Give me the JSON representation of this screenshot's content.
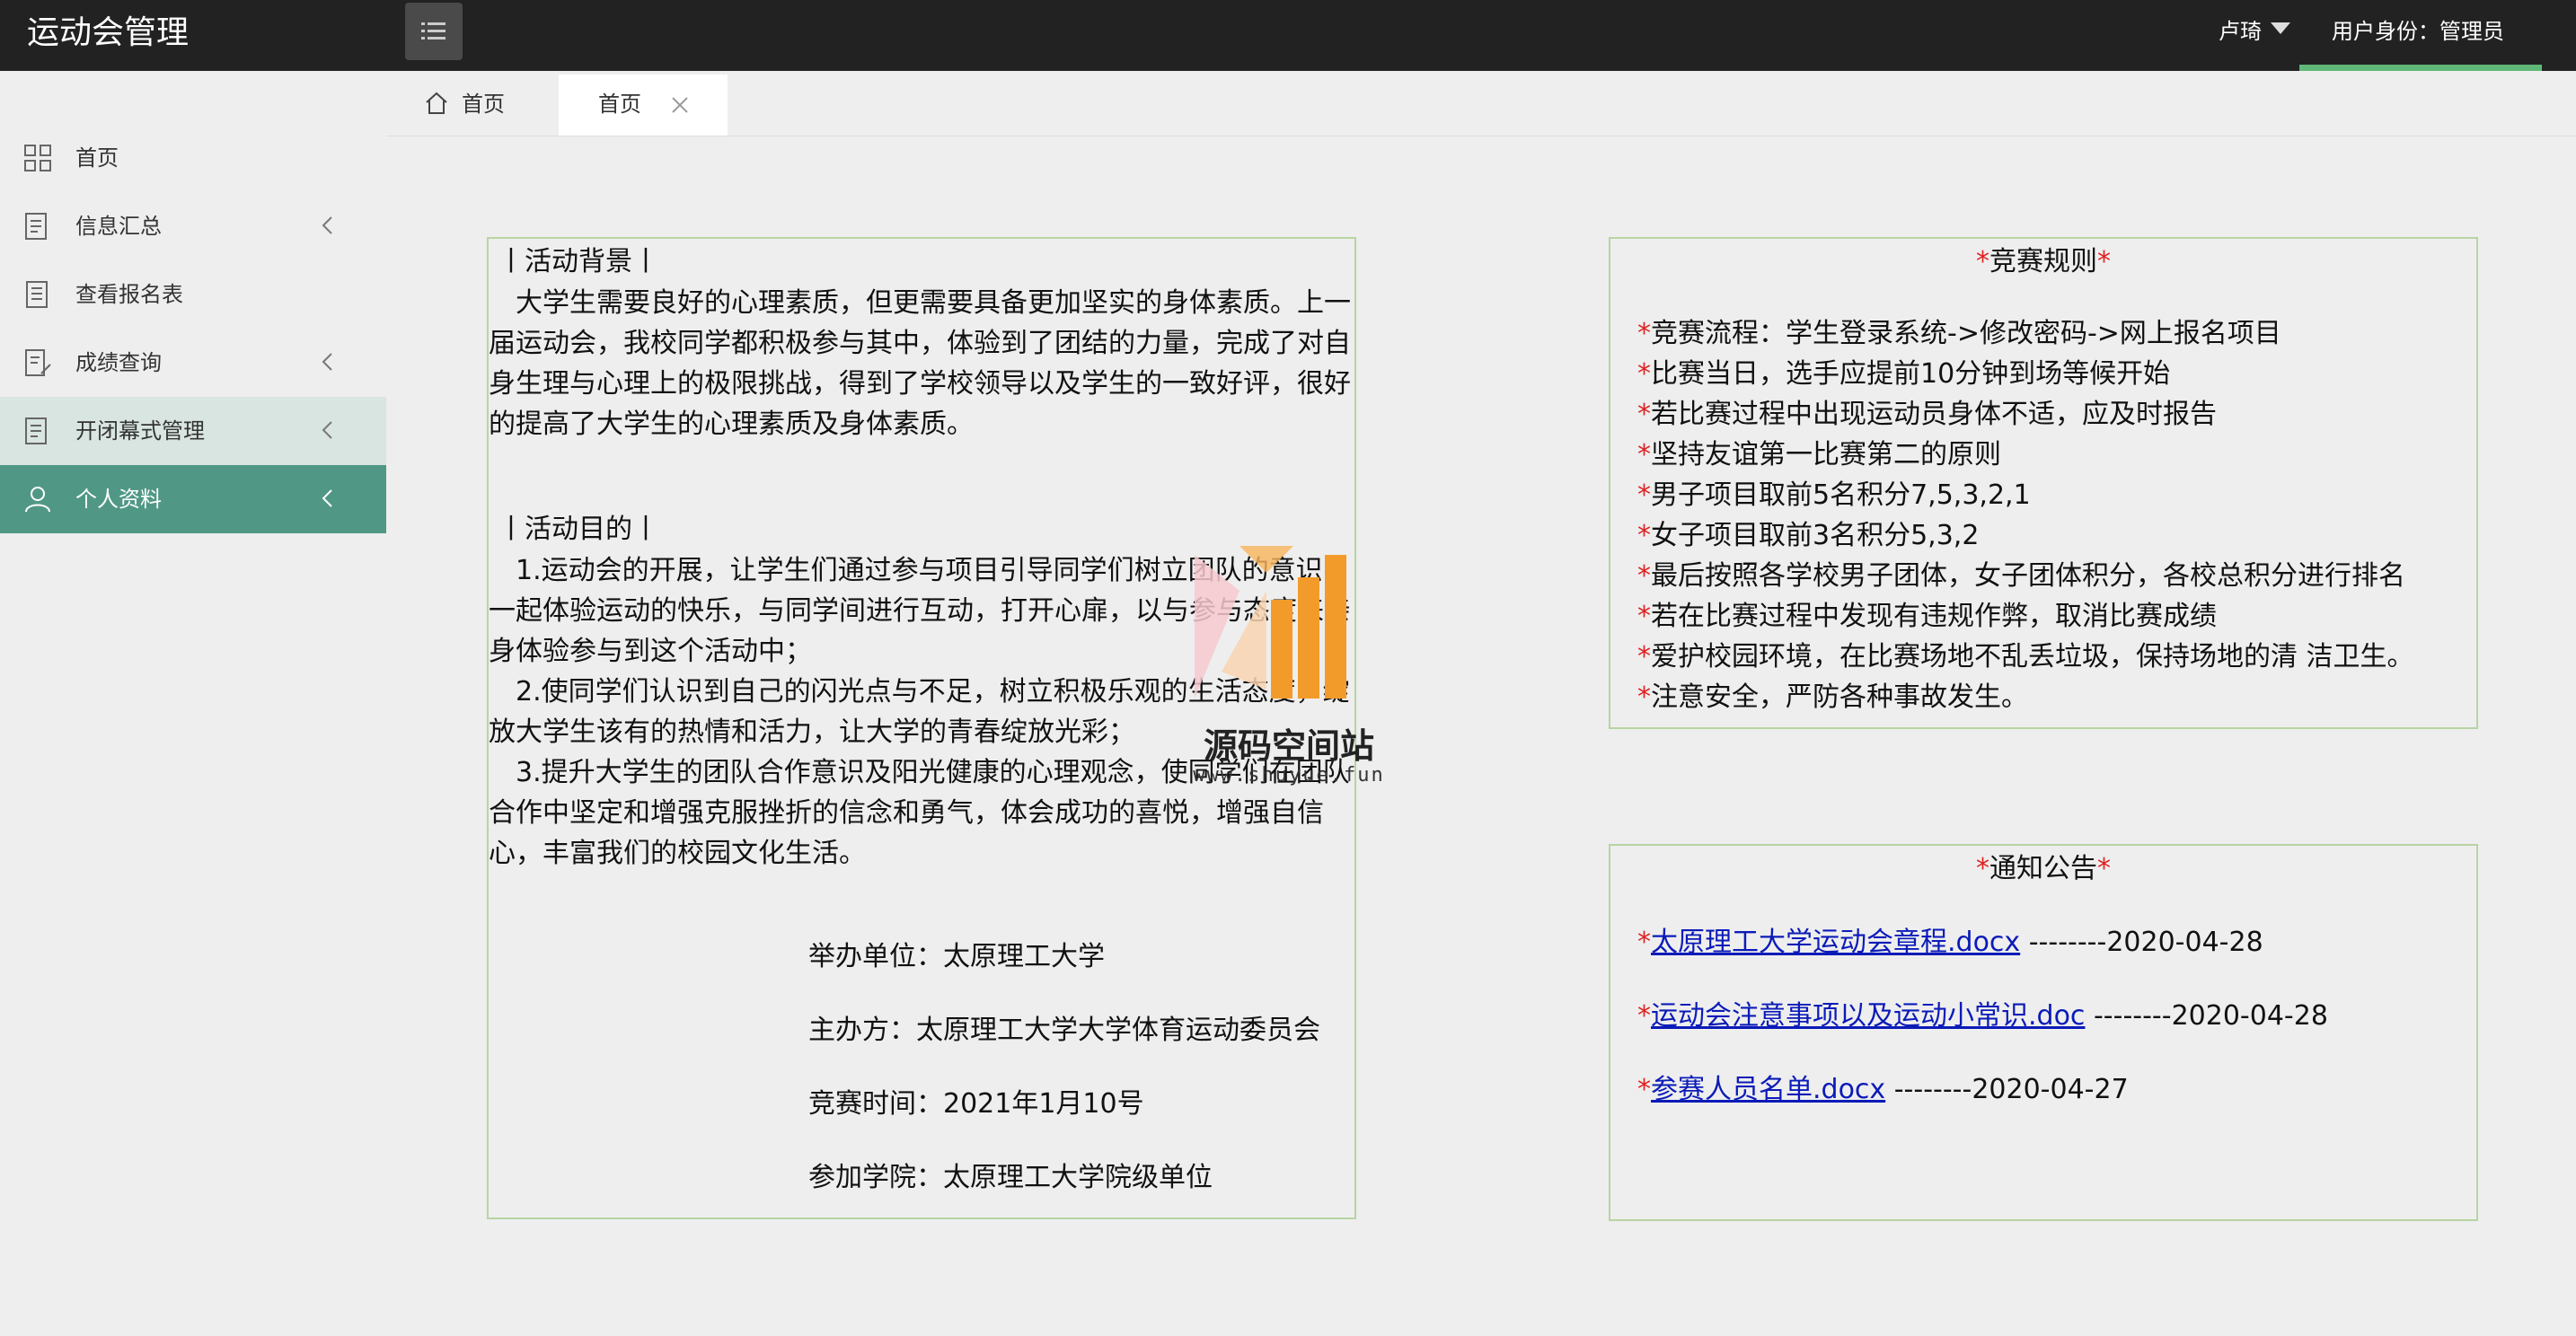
{
  "app": {
    "title": "运动会管理"
  },
  "header": {
    "user_name": "卢琦",
    "role_text": "用户身份：管理员",
    "menu_icon": "list-icon",
    "accent_color": "#5fb878"
  },
  "sidebar": {
    "items": [
      {
        "label": "首页",
        "icon": "grid-icon",
        "has_arrow": false,
        "state": "normal"
      },
      {
        "label": "信息汇总",
        "icon": "document-icon",
        "has_arrow": true,
        "state": "normal"
      },
      {
        "label": "查看报名表",
        "icon": "list-doc-icon",
        "has_arrow": false,
        "state": "normal"
      },
      {
        "label": "成绩查询",
        "icon": "edit-doc-icon",
        "has_arrow": true,
        "state": "normal"
      },
      {
        "label": "开闭幕式管理",
        "icon": "document-icon",
        "has_arrow": true,
        "state": "hover"
      },
      {
        "label": "个人资料",
        "icon": "user-icon",
        "has_arrow": true,
        "state": "active"
      }
    ],
    "active_color": "#509885",
    "hover_color": "#d9e5e0"
  },
  "tabs": [
    {
      "label": "首页",
      "icon": "home-icon",
      "active": false
    },
    {
      "label": "首页",
      "icon": "close-icon",
      "active": true
    }
  ],
  "activity": {
    "background_heading": "丨活动背景丨",
    "background_text": "　大学生需要良好的心理素质，但更需要具备更加坚实的身体素质。上一届运动会，我校同学都积极参与其中，体验到了团结的力量，完成了对自身生理与心理上的极限挑战，得到了学校领导以及学生的一致好评，很好的提高了大学生的心理素质及身体素质。",
    "purpose_heading": "丨活动目的丨",
    "purpose_1": "　1.运动会的开展，让学生们通过参与项目引导同学们树立团队的意识，一起体验运动的快乐，与同学间进行互动，打开心扉，以与参与态度来亲身体验参与到这个活动中；",
    "purpose_2": "　2.使同学们认识到自己的闪光点与不足，树立积极乐观的生活态度，绽放大学生该有的热情和活力，让大学的青春绽放光彩；",
    "purpose_3": "　3.提升大学生的团队合作意识及阳光健康的心理观念，使同学们在团队合作中坚定和增强克服挫折的信念和勇气，体会成功的喜悦，增强自信心，丰富我们的校园文化生活。",
    "organizer": "举办单位：太原理工大学",
    "host": "主办方：太原理工大学大学体育运动委员会",
    "time": "竞赛时间：2021年1月10号",
    "participants": "参加学院：太原理工大学院级单位"
  },
  "rules": {
    "star": "*",
    "title": "竞赛规则",
    "items": [
      "竞赛流程：学生登录系统->修改密码->网上报名项目",
      "比赛当日，选手应提前10分钟到场等候开始",
      "若比赛过程中出现运动员身体不适，应及时报告",
      "坚持友谊第一比赛第二的原则",
      "男子项目取前5名积分7,5,3,2,1",
      "女子项目取前3名积分5,3,2",
      "最后按照各学校男子团体，女子团体积分，各校总积分进行排名",
      "若在比赛过程中发现有违规作弊，取消比赛成绩",
      "爱护校园环境，在比赛场地不乱丢垃圾，保持场地的清 洁卫生。",
      "注意安全，严防各种事故发生。"
    ]
  },
  "notices": {
    "title": "通知公告",
    "items": [
      {
        "link": "太原理工大学运动会章程.docx",
        "date": " --------2020-04-28"
      },
      {
        "link": "运动会注意事项以及运动小常识.doc",
        "date": " --------2020-04-28"
      },
      {
        "link": "参赛人员名单.docx",
        "date": " --------2020-04-27"
      }
    ]
  },
  "watermark": {
    "name": "源码空间站",
    "url": "www.shuyue.fun"
  }
}
